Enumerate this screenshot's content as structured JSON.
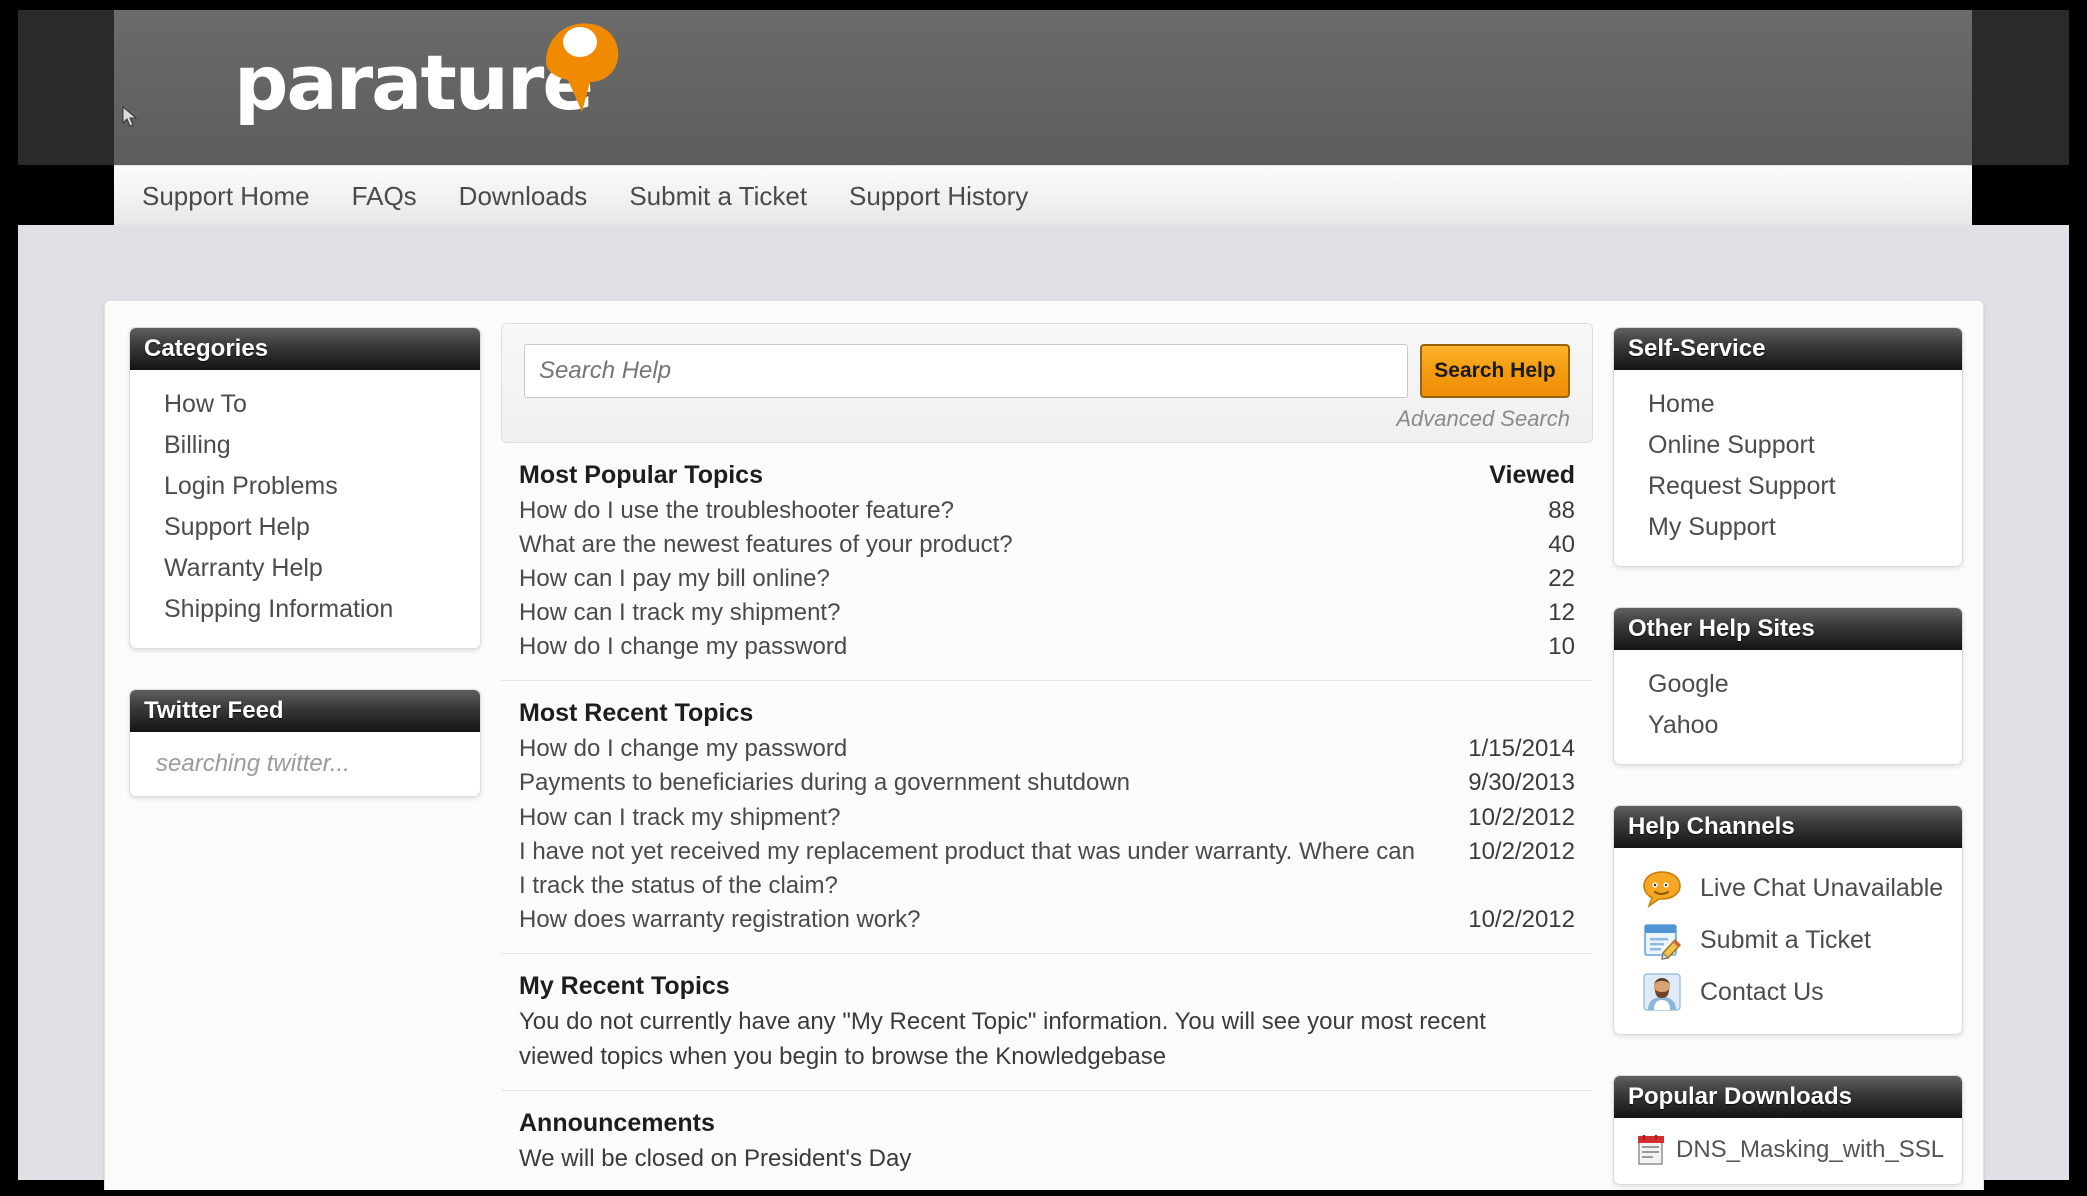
{
  "brand": {
    "name": "parature",
    "accent_color": "#f08a00",
    "header_bg": "#646464"
  },
  "nav": {
    "items": [
      {
        "label": "Support Home"
      },
      {
        "label": "FAQs"
      },
      {
        "label": "Downloads"
      },
      {
        "label": "Submit a Ticket"
      },
      {
        "label": "Support History"
      }
    ]
  },
  "left_sidebar": {
    "categories": {
      "title": "Categories",
      "items": [
        {
          "label": "How To"
        },
        {
          "label": "Billing"
        },
        {
          "label": "Login Problems"
        },
        {
          "label": "Support Help"
        },
        {
          "label": "Warranty Help"
        },
        {
          "label": "Shipping Information"
        }
      ]
    },
    "twitter": {
      "title": "Twitter Feed",
      "status": "searching twitter..."
    }
  },
  "search": {
    "placeholder": "Search Help",
    "value": "",
    "button_label": "Search Help",
    "advanced_label": "Advanced Search"
  },
  "main": {
    "popular": {
      "title": "Most Popular Topics",
      "column_label": "Viewed",
      "rows": [
        {
          "title": "How do I use the troubleshooter feature?",
          "viewed": "88"
        },
        {
          "title": "What are the newest features of your product?",
          "viewed": "40"
        },
        {
          "title": "How can I pay my bill online?",
          "viewed": "22"
        },
        {
          "title": "How can I track my shipment?",
          "viewed": "12"
        },
        {
          "title": "How do I change my password",
          "viewed": "10"
        }
      ]
    },
    "recent": {
      "title": "Most Recent Topics",
      "rows": [
        {
          "title": "How do I change my password",
          "date": "1/15/2014"
        },
        {
          "title": "Payments to beneficiaries during a government shutdown",
          "date": "9/30/2013"
        },
        {
          "title": "How can I track my shipment?",
          "date": "10/2/2012"
        },
        {
          "title": "I have not yet received my replacement product that was under warranty. Where can I track the status of the claim?",
          "date": "10/2/2012"
        },
        {
          "title": "How does warranty registration work?",
          "date": "10/2/2012"
        }
      ]
    },
    "my_recent": {
      "title": "My Recent Topics",
      "empty_text": "You do not currently have any \"My Recent Topic\" information. You will see your most recent viewed topics when you begin to browse the Knowledgebase"
    },
    "announcements": {
      "title": "Announcements",
      "text": "We will be closed on President's Day"
    }
  },
  "right_sidebar": {
    "self_service": {
      "title": "Self-Service",
      "items": [
        {
          "label": "Home"
        },
        {
          "label": "Online Support"
        },
        {
          "label": "Request Support"
        },
        {
          "label": "My Support"
        }
      ]
    },
    "other_help_sites": {
      "title": "Other Help Sites",
      "items": [
        {
          "label": "Google"
        },
        {
          "label": "Yahoo"
        }
      ]
    },
    "help_channels": {
      "title": "Help Channels",
      "items": [
        {
          "label": "Live Chat Unavailable",
          "icon": "chat-bubble-icon"
        },
        {
          "label": "Submit a Ticket",
          "icon": "form-pencil-icon"
        },
        {
          "label": "Contact Us",
          "icon": "person-icon"
        }
      ]
    },
    "popular_downloads": {
      "title": "Popular Downloads",
      "items": [
        {
          "label": "DNS_Masking_with_SSL",
          "icon": "pdf-icon"
        }
      ]
    }
  }
}
